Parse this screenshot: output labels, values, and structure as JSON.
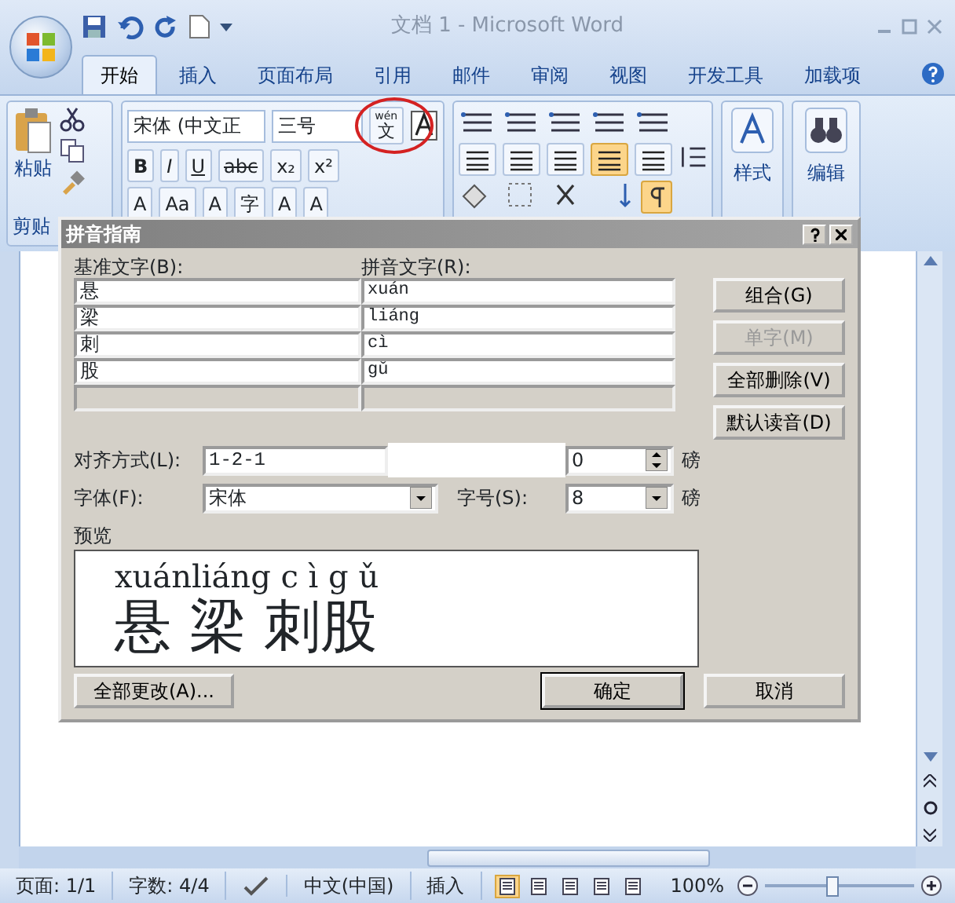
{
  "window": {
    "title": "文档 1 - Microsoft Word"
  },
  "ribbon_tabs": [
    {
      "label": "开始",
      "selected": true
    },
    {
      "label": "插入",
      "selected": false
    },
    {
      "label": "页面布局",
      "selected": false
    },
    {
      "label": "引用",
      "selected": false
    },
    {
      "label": "邮件",
      "selected": false
    },
    {
      "label": "审阅",
      "selected": false
    },
    {
      "label": "视图",
      "selected": false
    },
    {
      "label": "开发工具",
      "selected": false
    },
    {
      "label": "加载项",
      "selected": false
    }
  ],
  "ribbon": {
    "paste_label": "粘贴",
    "clipboard_group": "剪贴",
    "font_name": "宋体 (中文正",
    "font_size": "三号",
    "phonetic_guide": {
      "ruby": "wén",
      "char": "文"
    },
    "format_row": [
      "B",
      "I",
      "U",
      "abc",
      "x₂",
      "x²"
    ],
    "effects_row": [
      "A",
      "Aa",
      "A",
      "字",
      "A",
      "A"
    ],
    "alignment": [
      {
        "selected": false
      },
      {
        "selected": false
      },
      {
        "selected": false
      },
      {
        "selected": true
      },
      {
        "selected": false
      }
    ],
    "show_formatting": {
      "on": true
    },
    "styles_label": "样式",
    "editing_label": "编辑"
  },
  "dialog": {
    "title": "拼音指南",
    "base_header": "基准文字(B):",
    "ruby_header": "拼音文字(R):",
    "rows": [
      {
        "base": "悬",
        "ruby": "xuán"
      },
      {
        "base": "梁",
        "ruby": "liáng"
      },
      {
        "base": "刺",
        "ruby": "cì"
      },
      {
        "base": "股",
        "ruby": "gǔ"
      }
    ],
    "side_buttons": [
      {
        "label": "组合(G)",
        "disabled": false
      },
      {
        "label": "单字(M)",
        "disabled": true
      },
      {
        "label": "全部删除(V)",
        "disabled": false
      },
      {
        "label": "默认读音(D)",
        "disabled": false
      }
    ],
    "alignment_label": "对齐方式(L):",
    "alignment_value": "1-2-1",
    "offset_value": "0",
    "offset_unit": "磅",
    "font_label": "字体(F):",
    "font_value": "宋体",
    "size_label": "字号(S):",
    "size_value": "8",
    "size_unit": "磅",
    "preview_label": "预览",
    "preview_ruby": "xuánliáng c ì g ǔ",
    "preview_base": "悬 梁 刺股",
    "footer_buttons": [
      {
        "label": "全部更改(A)...",
        "default": false
      },
      {
        "label": "确定",
        "default": true
      },
      {
        "label": "取消",
        "default": false
      }
    ]
  },
  "status_bar": {
    "page": "页面: 1/1",
    "words": "字数: 4/4",
    "language": "中文(中国)",
    "mode": "插入",
    "views": [
      {
        "selected": true
      },
      {
        "selected": false
      },
      {
        "selected": false
      },
      {
        "selected": false
      },
      {
        "selected": false
      }
    ],
    "zoom": "100%",
    "zoom_slider": {
      "level": 0.45
    }
  }
}
